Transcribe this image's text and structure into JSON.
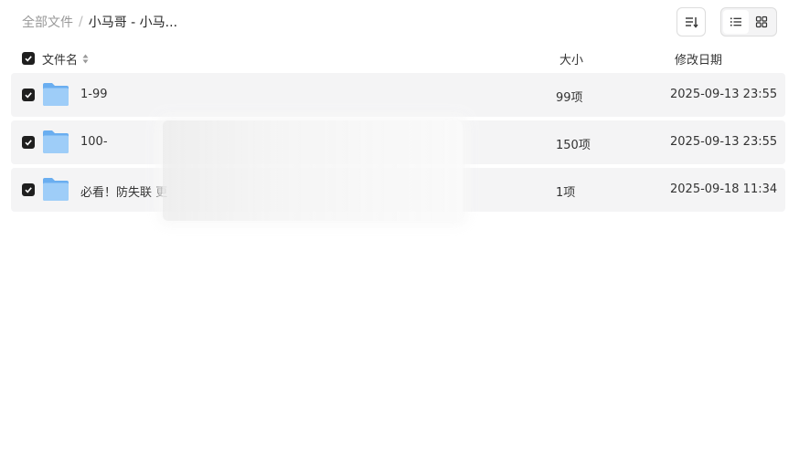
{
  "breadcrumb": {
    "root": "全部文件",
    "separator": "/",
    "current": "小马哥 - 小马..."
  },
  "toolbar": {
    "sort_icon": "sort-lines-icon",
    "view_list_icon": "list-view-icon",
    "view_grid_icon": "grid-view-icon",
    "active_view": "list"
  },
  "header": {
    "name": "文件名",
    "size": "大小",
    "date": "修改日期"
  },
  "files": [
    {
      "name": "1-99",
      "size": "99项",
      "date": "2025-09-13 23:55",
      "icon": "folder-icon"
    },
    {
      "name": "100-",
      "size": "150项",
      "date": "2025-09-13 23:55",
      "icon": "folder-icon"
    },
    {
      "name": "必看！防失联 更",
      "size": "1项",
      "date": "2025-09-18 11:34",
      "icon": "folder-icon"
    }
  ],
  "colors": {
    "row_bg": "#f4f4f5",
    "checkbox": "#1f1f1f",
    "folder": "#7cb8f2"
  }
}
